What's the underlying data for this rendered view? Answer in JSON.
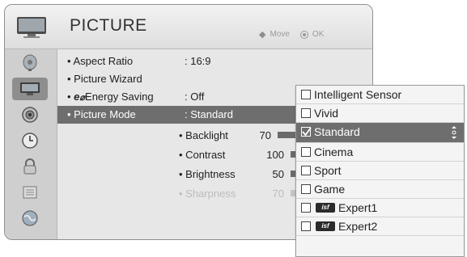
{
  "header": {
    "title": "PICTURE",
    "hint_move_label": "Move",
    "hint_ok_label": "OK"
  },
  "sidebar": {
    "items": [
      {
        "icon": "satellite-dish-icon",
        "active": false
      },
      {
        "icon": "picture-icon",
        "active": true
      },
      {
        "icon": "speaker-icon",
        "active": false
      },
      {
        "icon": "clock-icon",
        "active": false
      },
      {
        "icon": "lock-icon",
        "active": false
      },
      {
        "icon": "option-icon",
        "active": false
      },
      {
        "icon": "globe-icon",
        "active": false
      }
    ]
  },
  "menu": {
    "items": [
      {
        "label": "Aspect Ratio",
        "value": ": 16:9"
      },
      {
        "label": "Picture Wizard",
        "value": ""
      },
      {
        "label": "Energy Saving",
        "value": ": Off",
        "prefix": "e"
      },
      {
        "label": "Picture Mode",
        "value": ": Standard",
        "selected": true
      }
    ],
    "sub_items": [
      {
        "label": "Backlight",
        "value": "70",
        "level": 70
      },
      {
        "label": "Contrast",
        "value": "100",
        "level": 100
      },
      {
        "label": "Brightness",
        "value": "50",
        "level": 50
      },
      {
        "label": "Sharpness",
        "value": "70",
        "level": 70,
        "dimmed": true
      }
    ]
  },
  "dropdown": {
    "options": [
      {
        "label": "Intelligent Sensor",
        "checked": false
      },
      {
        "label": "Vivid",
        "checked": false
      },
      {
        "label": "Standard",
        "checked": true,
        "selected": true
      },
      {
        "label": "Cinema",
        "checked": false
      },
      {
        "label": "Sport",
        "checked": false
      },
      {
        "label": "Game",
        "checked": false
      },
      {
        "label": "Expert1",
        "checked": false,
        "badge": "isf"
      },
      {
        "label": "Expert2",
        "checked": false,
        "badge": "isf"
      }
    ]
  },
  "colors": {
    "highlight": "#6e6e6e",
    "panel": "#d8d8d8",
    "content": "#e7e7e7"
  }
}
